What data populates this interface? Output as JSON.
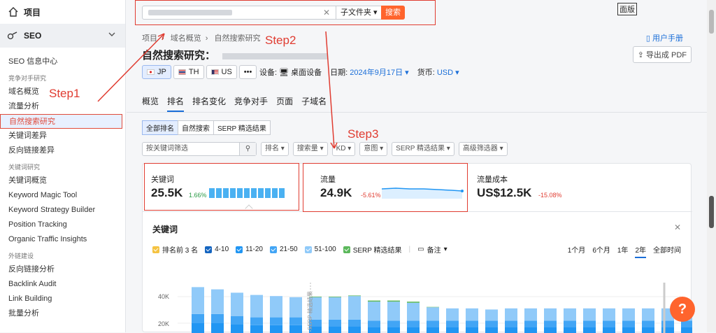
{
  "sidebar": {
    "home_label": "项目",
    "seo_label": "SEO",
    "items_top": [
      "SEO 信息中心"
    ],
    "group1_title": "竞争对手研究",
    "group1_items": [
      "域名概览",
      "流量分析",
      "自然搜索研究",
      "关键词差异",
      "反向链接差异"
    ],
    "group2_title": "关键词研究",
    "group2_items": [
      "关键词概览",
      "Keyword Magic Tool",
      "Keyword Strategy Builder",
      "Position Tracking",
      "Organic Traffic Insights"
    ],
    "group3_title": "外链建设",
    "group3_items": [
      "反向链接分析",
      "Backlink Audit",
      "Link Building",
      "批量分析"
    ]
  },
  "search": {
    "scope": "子文件夹",
    "button": "搜索"
  },
  "panel_label": "面版",
  "breadcrumb": [
    "项目",
    "域名概览",
    "自然搜索研究"
  ],
  "manual_label": "用户手册",
  "export_label": "导出成 PDF",
  "page_title": "自然搜索研究：",
  "countries": [
    "JP",
    "TH",
    "US",
    "•••"
  ],
  "meta": {
    "device_label": "设备:",
    "device_value": "桌面设备",
    "date_label": "日期:",
    "date_value": "2024年9月17日",
    "currency_label": "货币:",
    "currency_value": "USD"
  },
  "tabs": [
    "概览",
    "排名",
    "排名变化",
    "竞争对手",
    "页面",
    "子域名"
  ],
  "segments": [
    "全部排名",
    "自然搜索",
    "SERP 精选结果"
  ],
  "filters": {
    "search_placeholder": "按关键词筛选",
    "items": [
      "排名",
      "搜索量",
      "KD",
      "意图",
      "SERP 精选结果",
      "高级筛选器"
    ]
  },
  "metrics": [
    {
      "label": "关键词",
      "value": "25.5K",
      "change": "1.66%"
    },
    {
      "label": "流量",
      "value": "24.9K",
      "change": "-5.61%"
    },
    {
      "label": "流量成本",
      "value": "US$12.5K",
      "change": "-15.08%"
    }
  ],
  "keyword_panel": {
    "title": "关键词",
    "legend": [
      "排名前 3 名",
      "4-10",
      "11-20",
      "21-50",
      "51-100",
      "SERP 精选结果"
    ],
    "notes_label": "备注",
    "periods": [
      "1个月",
      "6个月",
      "1年",
      "2年",
      "全部时间"
    ],
    "selected_period": "2年",
    "serp_annotation": "SERP 精选结果"
  },
  "annotations": {
    "step1": "Step1",
    "step2": "Step2",
    "step3": "Step3"
  },
  "help_label": "?",
  "colors": {
    "accent": "#ff642d",
    "link": "#1a6ed8",
    "annotation": "#e03c31",
    "top3": "#f5c342",
    "c410": "#1565c0",
    "c1120": "#2196f3",
    "c2150": "#42a5f5",
    "c51100": "#90caf9",
    "serp": "#5cb85c"
  },
  "chart_data": {
    "type": "bar",
    "y_ticks": [
      "40K",
      "20K"
    ],
    "stack_order": [
      "11-20",
      "21-50",
      "51-100",
      "SERP 精选结果"
    ],
    "series": [
      {
        "name": "11-20",
        "values": [
          9,
          9,
          8,
          7,
          7,
          7,
          6,
          6,
          6,
          5,
          5,
          5,
          5,
          5,
          5,
          5,
          5,
          5,
          5,
          5,
          5,
          5,
          5,
          5,
          5,
          5
        ]
      },
      {
        "name": "21-50",
        "values": [
          8,
          8,
          7,
          7,
          7,
          7,
          6,
          6,
          6,
          6,
          6,
          6,
          6,
          6,
          6,
          6,
          6,
          6,
          6,
          6,
          6,
          6,
          6,
          6,
          6,
          6
        ]
      },
      {
        "name": "51-100",
        "values": [
          24,
          22,
          21,
          20,
          19,
          18,
          20,
          20,
          21,
          17,
          17,
          16,
          12,
          11,
          11,
          10,
          11,
          11,
          11,
          11,
          11,
          11,
          11,
          11,
          11,
          11
        ]
      },
      {
        "name": "SERP 精选结果",
        "values": [
          0,
          0,
          0,
          0,
          0,
          0,
          0.5,
          0.5,
          0.5,
          1,
          1,
          1,
          0.3,
          0,
          0,
          0,
          0,
          0,
          0,
          0,
          0,
          0,
          0,
          0,
          0,
          0
        ]
      }
    ],
    "categories": 26,
    "ylim": [
      0,
      48
    ]
  }
}
